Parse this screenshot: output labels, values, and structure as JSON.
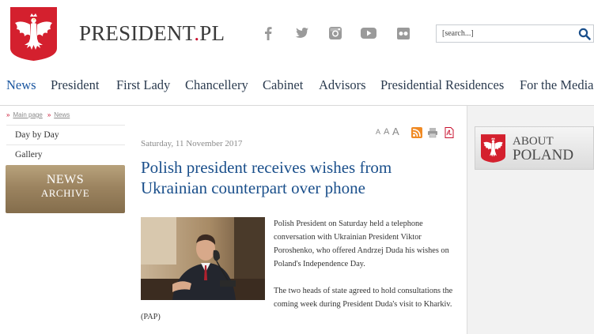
{
  "header": {
    "site_title_main": "PRESIDENT",
    "site_title_dot": ".",
    "site_title_tld": "PL",
    "social": [
      "facebook-icon",
      "twitter-icon",
      "instagram-icon",
      "youtube-icon",
      "flickr-icon"
    ],
    "search": {
      "placeholder": "[search...]"
    }
  },
  "nav": {
    "items": [
      "News",
      "President",
      "First Lady",
      "Chancellery",
      "Cabinet",
      "Advisors",
      "Presidential Residences",
      "For the Media"
    ],
    "active": "News"
  },
  "breadcrumb": {
    "items": [
      "Main page",
      "News"
    ]
  },
  "sidebar": {
    "items": [
      "Day by Day",
      "Gallery"
    ],
    "archive_line1": "NEWS",
    "archive_line2": "ARCHIVE"
  },
  "tools": {
    "font_small": "A",
    "font_medium": "A",
    "font_large": "A"
  },
  "article": {
    "date": "Saturday, 11 November 2017",
    "title": "Polish president receives wishes from Ukrainian counterpart over phone",
    "paragraph1": "Polish President on Saturday held a telephone conversation with Ukrainian President Viktor Poroshenko, who offered Andrzej Duda his wishes on Poland's Independence Day.",
    "paragraph2": "The two heads of state agreed to hold consultations the coming week during President Duda's visit to Kharkiv.",
    "source": "(PAP)"
  },
  "about": {
    "line1": "ABOUT",
    "line2": "POLAND"
  },
  "colors": {
    "brand_red": "#c8102e",
    "link_blue": "#1a4f8b",
    "nav_text": "#2b3b4f"
  }
}
